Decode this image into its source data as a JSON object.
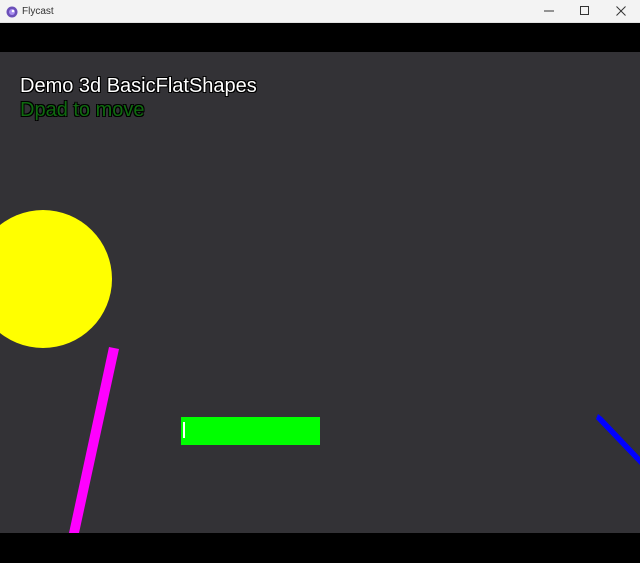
{
  "window": {
    "title": "Flycast",
    "icon": "flycast-app-icon",
    "controls": {
      "minimize_icon": "minimize-icon",
      "maximize_icon": "maximize-icon",
      "close_icon": "close-icon"
    }
  },
  "game": {
    "background_color": "#333236",
    "hud": {
      "title": "Demo 3d BasicFlatShapes",
      "subtitle": "Dpad to move",
      "title_color": "#ffffff",
      "subtitle_color": "#0f6a0f"
    },
    "shapes": [
      {
        "kind": "circle",
        "color": "#ffff00"
      },
      {
        "kind": "line",
        "color": "#ff00ff"
      },
      {
        "kind": "rectangle",
        "color": "#00ff00"
      },
      {
        "kind": "line",
        "color": "#0000ff"
      }
    ]
  }
}
